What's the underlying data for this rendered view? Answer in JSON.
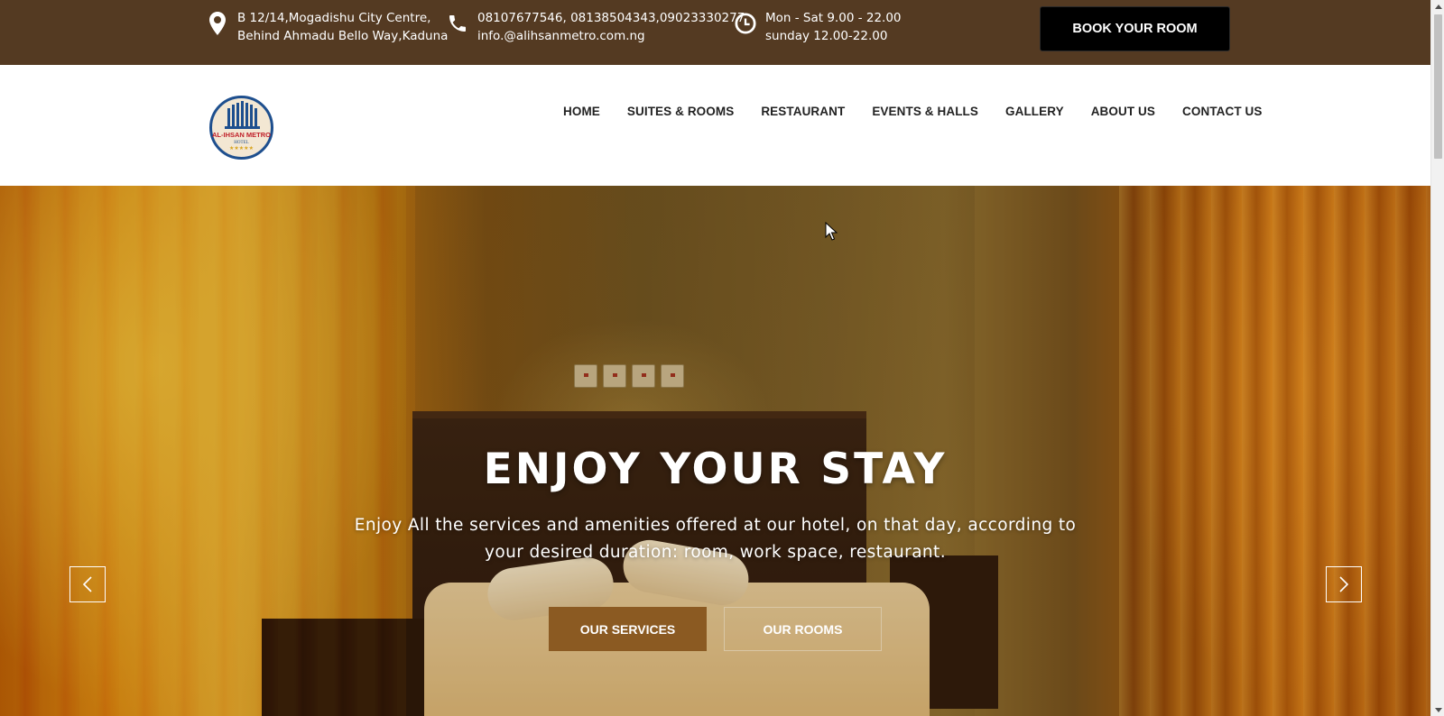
{
  "topbar": {
    "address_line1": "B 12/14,Mogadishu City Centre,",
    "address_line2": "Behind Ahmadu Bello Way,Kaduna",
    "phone_line1": "08107677546, 08138504343,09023330277",
    "phone_line2": "info.@alihsanmetro.com.ng",
    "hours_line1": "Mon - Sat 9.00 - 22.00",
    "hours_line2": "sunday 12.00-22.00",
    "book_label": "BOOK YOUR ROOM",
    "icons": [
      "map-pin-icon",
      "phone-icon",
      "clock-icon"
    ]
  },
  "logo": {
    "name": "AL-IHSAN METRO",
    "sub": "HOTEL"
  },
  "nav": {
    "items": [
      {
        "label": "HOME"
      },
      {
        "label": "SUITES & ROOMS"
      },
      {
        "label": "RESTAURANT"
      },
      {
        "label": "EVENTS & HALLS"
      },
      {
        "label": "GALLERY"
      },
      {
        "label": "ABOUT US"
      },
      {
        "label": "CONTACT US"
      }
    ]
  },
  "hero": {
    "title": "ENJOY YOUR STAY",
    "subtitle": "Enjoy All the services and amenities offered at our hotel, on that day, according to your desired duration: room, work space, restaurant.",
    "primary_button": "OUR SERVICES",
    "secondary_button": "OUR ROOMS",
    "prev_icon": "chevron-left-icon",
    "next_icon": "chevron-right-icon"
  },
  "colors": {
    "topbar_bg": "#543a22",
    "book_button_bg": "#000000",
    "services_button_bg": "#8b5a22",
    "nav_text": "#222222"
  }
}
